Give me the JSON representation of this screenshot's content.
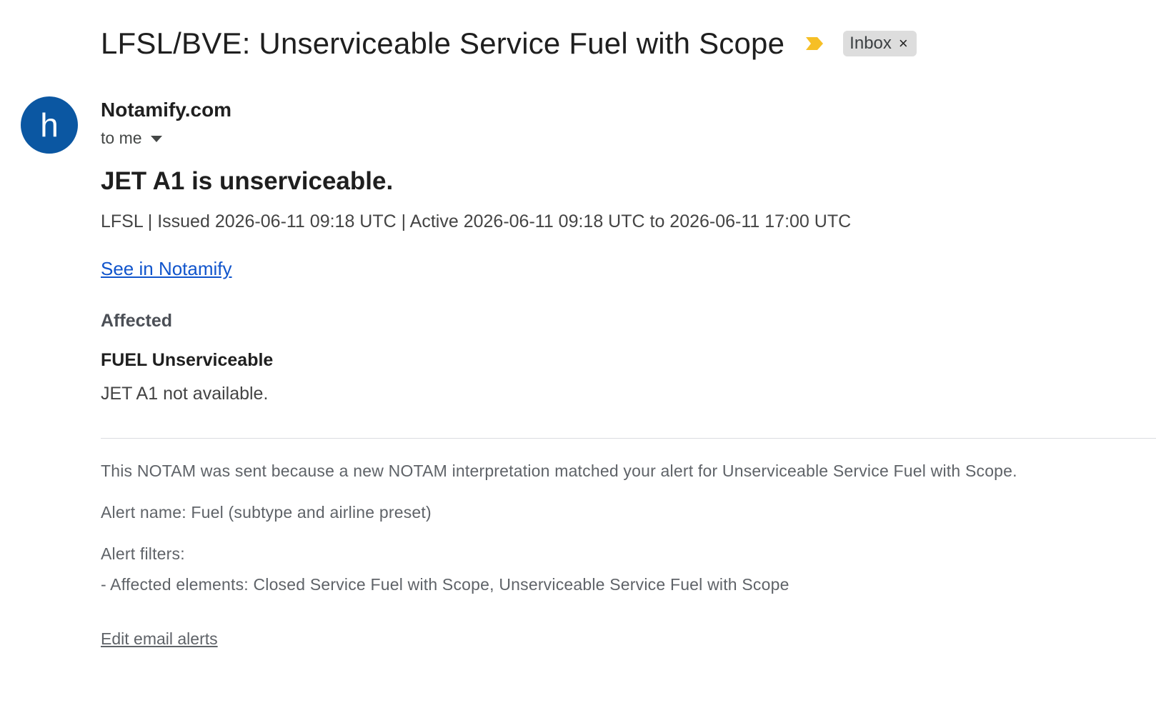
{
  "email": {
    "subject": "LFSL/BVE: Unserviceable Service Fuel with Scope",
    "importance_icon": "importance-marker-icon",
    "label": "Inbox",
    "label_close": "×",
    "avatar_letter": "h",
    "sender": "Notamify.com",
    "recipient": "to me"
  },
  "body": {
    "headline": "JET A1 is unserviceable.",
    "meta": "LFSL | Issued 2026-06-11 09:18 UTC | Active 2026-06-11 09:18 UTC to 2026-06-11 17:00 UTC",
    "link": "See in Notamify",
    "affected_heading": "Affected",
    "item_title": "FUEL Unserviceable",
    "item_description": "JET A1 not available."
  },
  "footer": {
    "reason": "This NOTAM was sent because a new NOTAM interpretation matched your alert for Unserviceable Service Fuel with Scope.",
    "alert_name": "Alert name: Fuel (subtype and airline preset)",
    "alert_filters_label": "Alert filters:",
    "alert_filter_item": "- Affected elements: Closed Service Fuel with Scope, Unserviceable Service Fuel with Scope",
    "edit_link": "Edit email alerts"
  },
  "colors": {
    "avatar": "#0b57a2",
    "link": "#1155cc",
    "importance": "#f6bf26"
  }
}
